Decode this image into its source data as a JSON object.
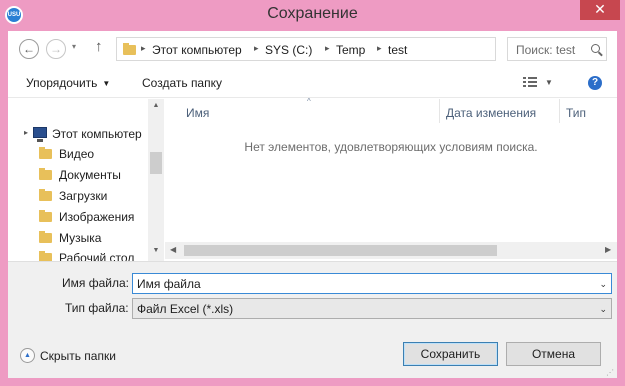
{
  "window": {
    "title": "Сохранение",
    "app_icon_text": "USU",
    "close_glyph": "✕"
  },
  "nav": {
    "back_glyph": "←",
    "forward_glyph": "→",
    "dropdown_glyph": "▾",
    "up_glyph": "↑",
    "breadcrumb": [
      "Этот компьютер",
      "SYS (C:)",
      "Temp",
      "test"
    ],
    "separator_glyph": "▸",
    "address_dropdown_glyph": "⌄",
    "refresh_glyph": "↻",
    "search_placeholder": "Поиск: test"
  },
  "toolbar": {
    "organize_label": "Упорядочить",
    "new_folder_label": "Создать папку",
    "dropdown_glyph": "▼",
    "help_glyph": "?"
  },
  "sidebar": {
    "root": {
      "label": "Этот компьютер",
      "expand_glyph": "▸",
      "icon": "computer-icon"
    },
    "items": [
      {
        "label": "Видео",
        "icon": "video-folder-icon"
      },
      {
        "label": "Документы",
        "icon": "documents-folder-icon"
      },
      {
        "label": "Загрузки",
        "icon": "downloads-folder-icon"
      },
      {
        "label": "Изображения",
        "icon": "pictures-folder-icon"
      },
      {
        "label": "Музыка",
        "icon": "music-folder-icon"
      },
      {
        "label": "Рабочий стол",
        "icon": "desktop-folder-icon"
      }
    ],
    "scroll_up_glyph": "▲",
    "scroll_down_glyph": "▼"
  },
  "filelist": {
    "columns": [
      "Имя",
      "Дата изменения",
      "Тип"
    ],
    "sort_glyph": "^",
    "empty_message": "Нет элементов, удовлетворяющих условиям поиска.",
    "scroll_left_glyph": "◀",
    "scroll_right_glyph": "▶"
  },
  "form": {
    "filename_label": "Имя файла:",
    "filename_value": "Имя файла",
    "filetype_label": "Тип файла:",
    "filetype_value": "Файл Excel (*.xls)",
    "combo_glyph": "⌄"
  },
  "footer": {
    "hide_folders_label": "Скрыть папки",
    "hide_folders_glyph": "▲",
    "save_label": "Сохранить",
    "cancel_label": "Отмена",
    "grip_glyph": "⋰"
  },
  "colors": {
    "frame": "#ee9bc3",
    "close_button": "#c7474f",
    "accent": "#3a8ad6"
  }
}
